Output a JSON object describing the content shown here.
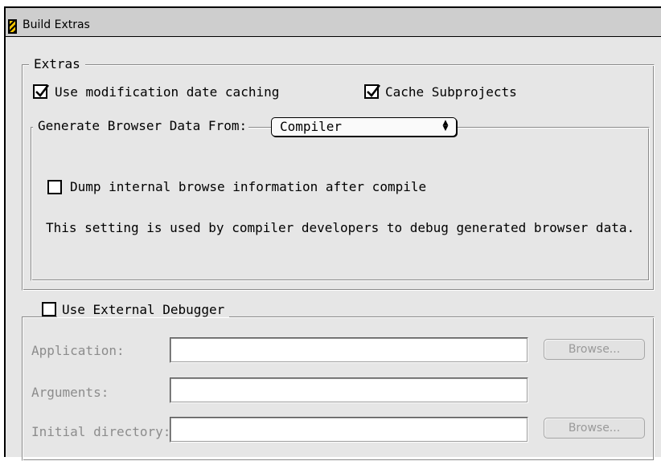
{
  "window": {
    "title": "Build Extras"
  },
  "extras": {
    "legend": "Extras",
    "modification_caching": {
      "label": "Use modification date caching",
      "checked": true
    },
    "cache_subprojects": {
      "label": "Cache Subprojects",
      "checked": true
    },
    "browser": {
      "legend_label": "Generate Browser Data From:",
      "selected": "Compiler",
      "dump_info": {
        "label": "Dump internal browse information after compile",
        "checked": false
      },
      "description": "This setting is used by compiler developers to debug generated browser data."
    }
  },
  "debugger": {
    "use_external": {
      "label": "Use External Debugger",
      "checked": false
    },
    "fields": {
      "application": {
        "label": "Application:",
        "value": "",
        "button": "Browse..."
      },
      "arguments": {
        "label": "Arguments:",
        "value": ""
      },
      "initial_directory": {
        "label": "Initial directory:",
        "value": "",
        "button": "Browse..."
      }
    }
  }
}
